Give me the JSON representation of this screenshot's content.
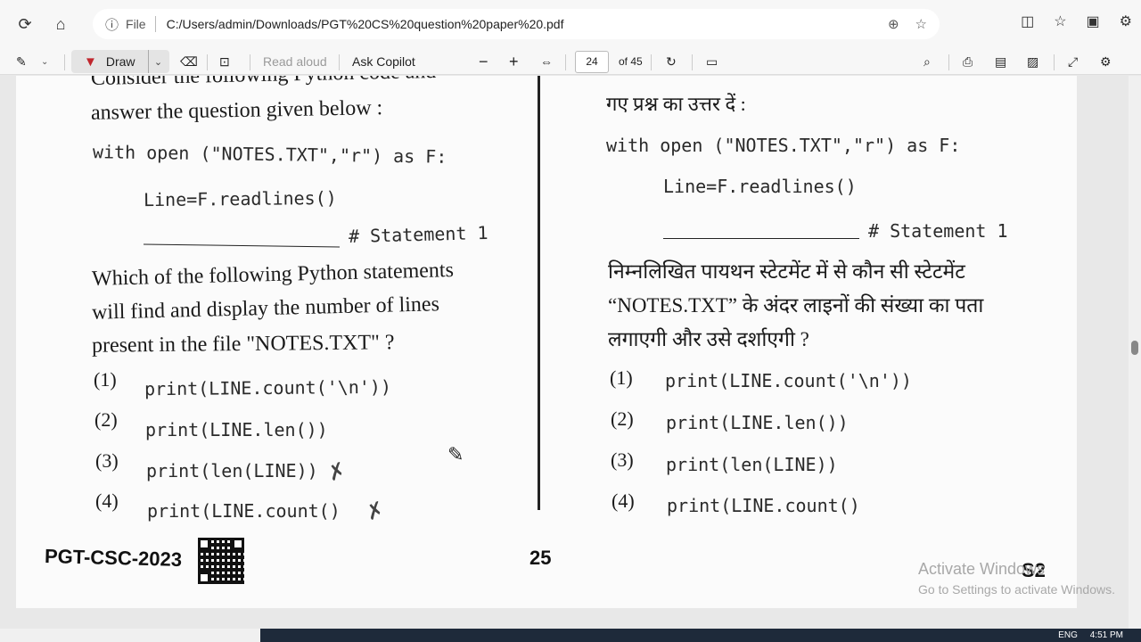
{
  "browser": {
    "address_info": "File",
    "url": "C:/Users/admin/Downloads/PGT%20CS%20question%20paper%20.pdf"
  },
  "toolbar": {
    "draw_label": "Draw",
    "read_aloud_label": "Read aloud",
    "ask_copilot_label": "Ask Copilot",
    "zoom_out": "−",
    "zoom_in": "+",
    "page_current": "24",
    "page_total": "of 45"
  },
  "left": {
    "intro_1": "Consider the following Python code and",
    "intro_2": "answer the question given below :",
    "code_1": "with open (\"NOTES.TXT\",\"r\") as F:",
    "code_2": "Line=F.readlines()",
    "statement": "# Statement 1",
    "question_1": "Which of the following Python statements",
    "question_2": "will find and display the number of lines",
    "question_3": "present in the file \"NOTES.TXT\" ?",
    "options": [
      {
        "num": "(1)",
        "code": "print(LINE.count('\\n'))"
      },
      {
        "num": "(2)",
        "code": "print(LINE.len())"
      },
      {
        "num": "(3)",
        "code": "print(len(LINE))"
      },
      {
        "num": "(4)",
        "code": "print(LINE.count()"
      }
    ]
  },
  "right": {
    "intro_2": "गए प्रश्न का उत्तर दें :",
    "code_1": "with open (\"NOTES.TXT\",\"r\") as F:",
    "code_2": "Line=F.readlines()",
    "statement": "# Statement 1",
    "question_1": "निम्नलिखित पायथन स्टेटमेंट में से कौन सी स्टेटमेंट",
    "question_2": "“NOTES.TXT” के अंदर लाइनों की संख्या का पता",
    "question_3": "लगाएगी और उसे दर्शाएगी ?",
    "options": [
      {
        "num": "(1)",
        "code": "print(LINE.count('\\n'))"
      },
      {
        "num": "(2)",
        "code": "print(LINE.len())"
      },
      {
        "num": "(3)",
        "code": "print(len(LINE))"
      },
      {
        "num": "(4)",
        "code": "print(LINE.count()"
      }
    ]
  },
  "footer": {
    "code": "PGT-CSC-2023",
    "page_number": "25",
    "set": "S2"
  },
  "watermark": {
    "line1": "Activate Windows",
    "line2": "Go to Settings to activate Windows."
  },
  "taskbar": {
    "lang": "ENG",
    "time": "4:51 PM"
  }
}
